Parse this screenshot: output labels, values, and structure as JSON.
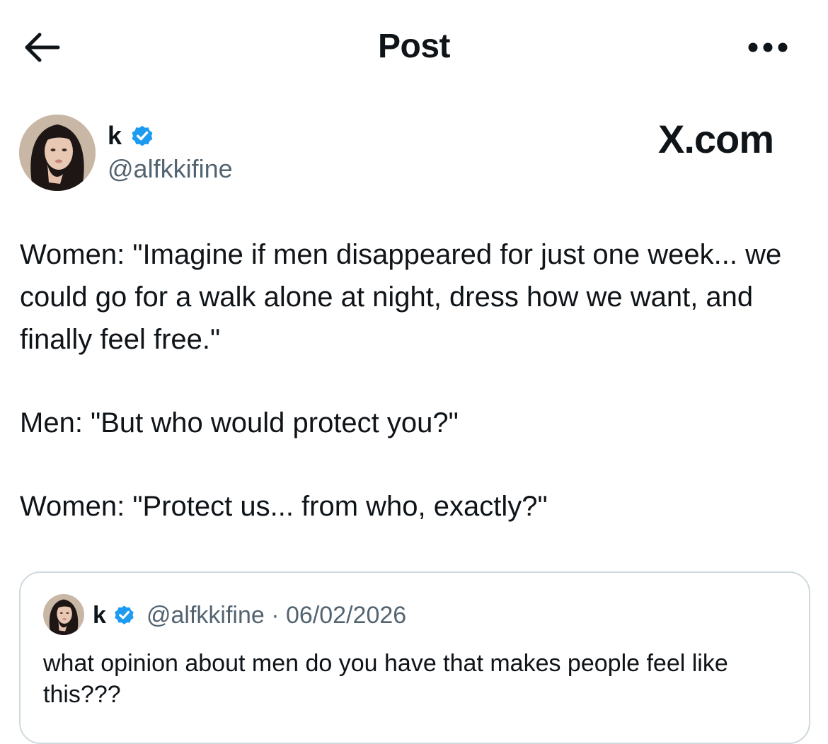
{
  "header": {
    "title": "Post",
    "back_icon": "arrow-left-icon",
    "more_icon": "more-horizontal-icon"
  },
  "author": {
    "display_name": "k",
    "handle": "@alfkkifine",
    "verified": true
  },
  "watermark": "X.com",
  "tweet": {
    "paragraphs": [
      "Women: \"Imagine if men disappeared for just one week... we could go for a walk alone at night, dress how we want, and finally feel free.\"",
      "Men: \"But who would protect you?\"",
      "Women: \"Protect us... from who, exactly?\""
    ]
  },
  "quoted": {
    "display_name": "k",
    "meta": "@alfkkifine · 06/02/2026",
    "text": "what opinion about men do you have that makes people feel like this???"
  },
  "colors": {
    "text": "#0f1419",
    "secondary": "#536471",
    "verified_blue": "#1d9bf0",
    "border": "#cfd9de"
  }
}
